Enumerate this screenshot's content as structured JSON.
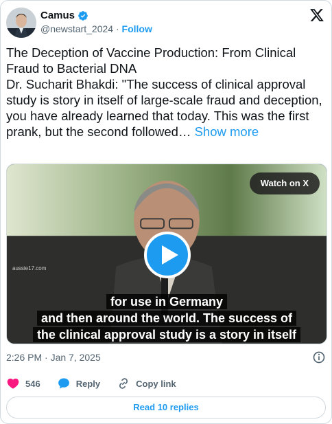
{
  "author": {
    "name": "Camus",
    "handle": "@newstart_2024",
    "separator": "·",
    "follow_label": "Follow"
  },
  "tweet": {
    "text": "The Deception of Vaccine Production: From Clinical Fraud to Bacterial DNA\nDr. Sucharit Bhakdi: \"The success of clinical approval study is story in itself of large-scale fraud and deception, you have already learned that today. This was the first  prank, but the second followed…",
    "show_more_label": "Show more"
  },
  "media": {
    "watch_label": "Watch on X",
    "watermark": "aussie17.com",
    "captions": [
      "for use in Germany",
      "and then around the world. The success of",
      "the clinical approval study is a story in itself"
    ]
  },
  "meta": {
    "timestamp": "2:26 PM · Jan 7, 2025"
  },
  "actions": {
    "likes_count": "546",
    "reply_label": "Reply",
    "copy_link_label": "Copy link"
  },
  "replies_button_label": "Read 10 replies",
  "colors": {
    "accent": "#1d9bf0",
    "like": "#f91880",
    "text": "#0f1419",
    "muted": "#536471",
    "border": "#cfd9de"
  },
  "icons": [
    "verified-badge-icon",
    "x-logo-icon",
    "play-icon",
    "info-icon",
    "heart-icon",
    "reply-icon",
    "link-icon"
  ]
}
